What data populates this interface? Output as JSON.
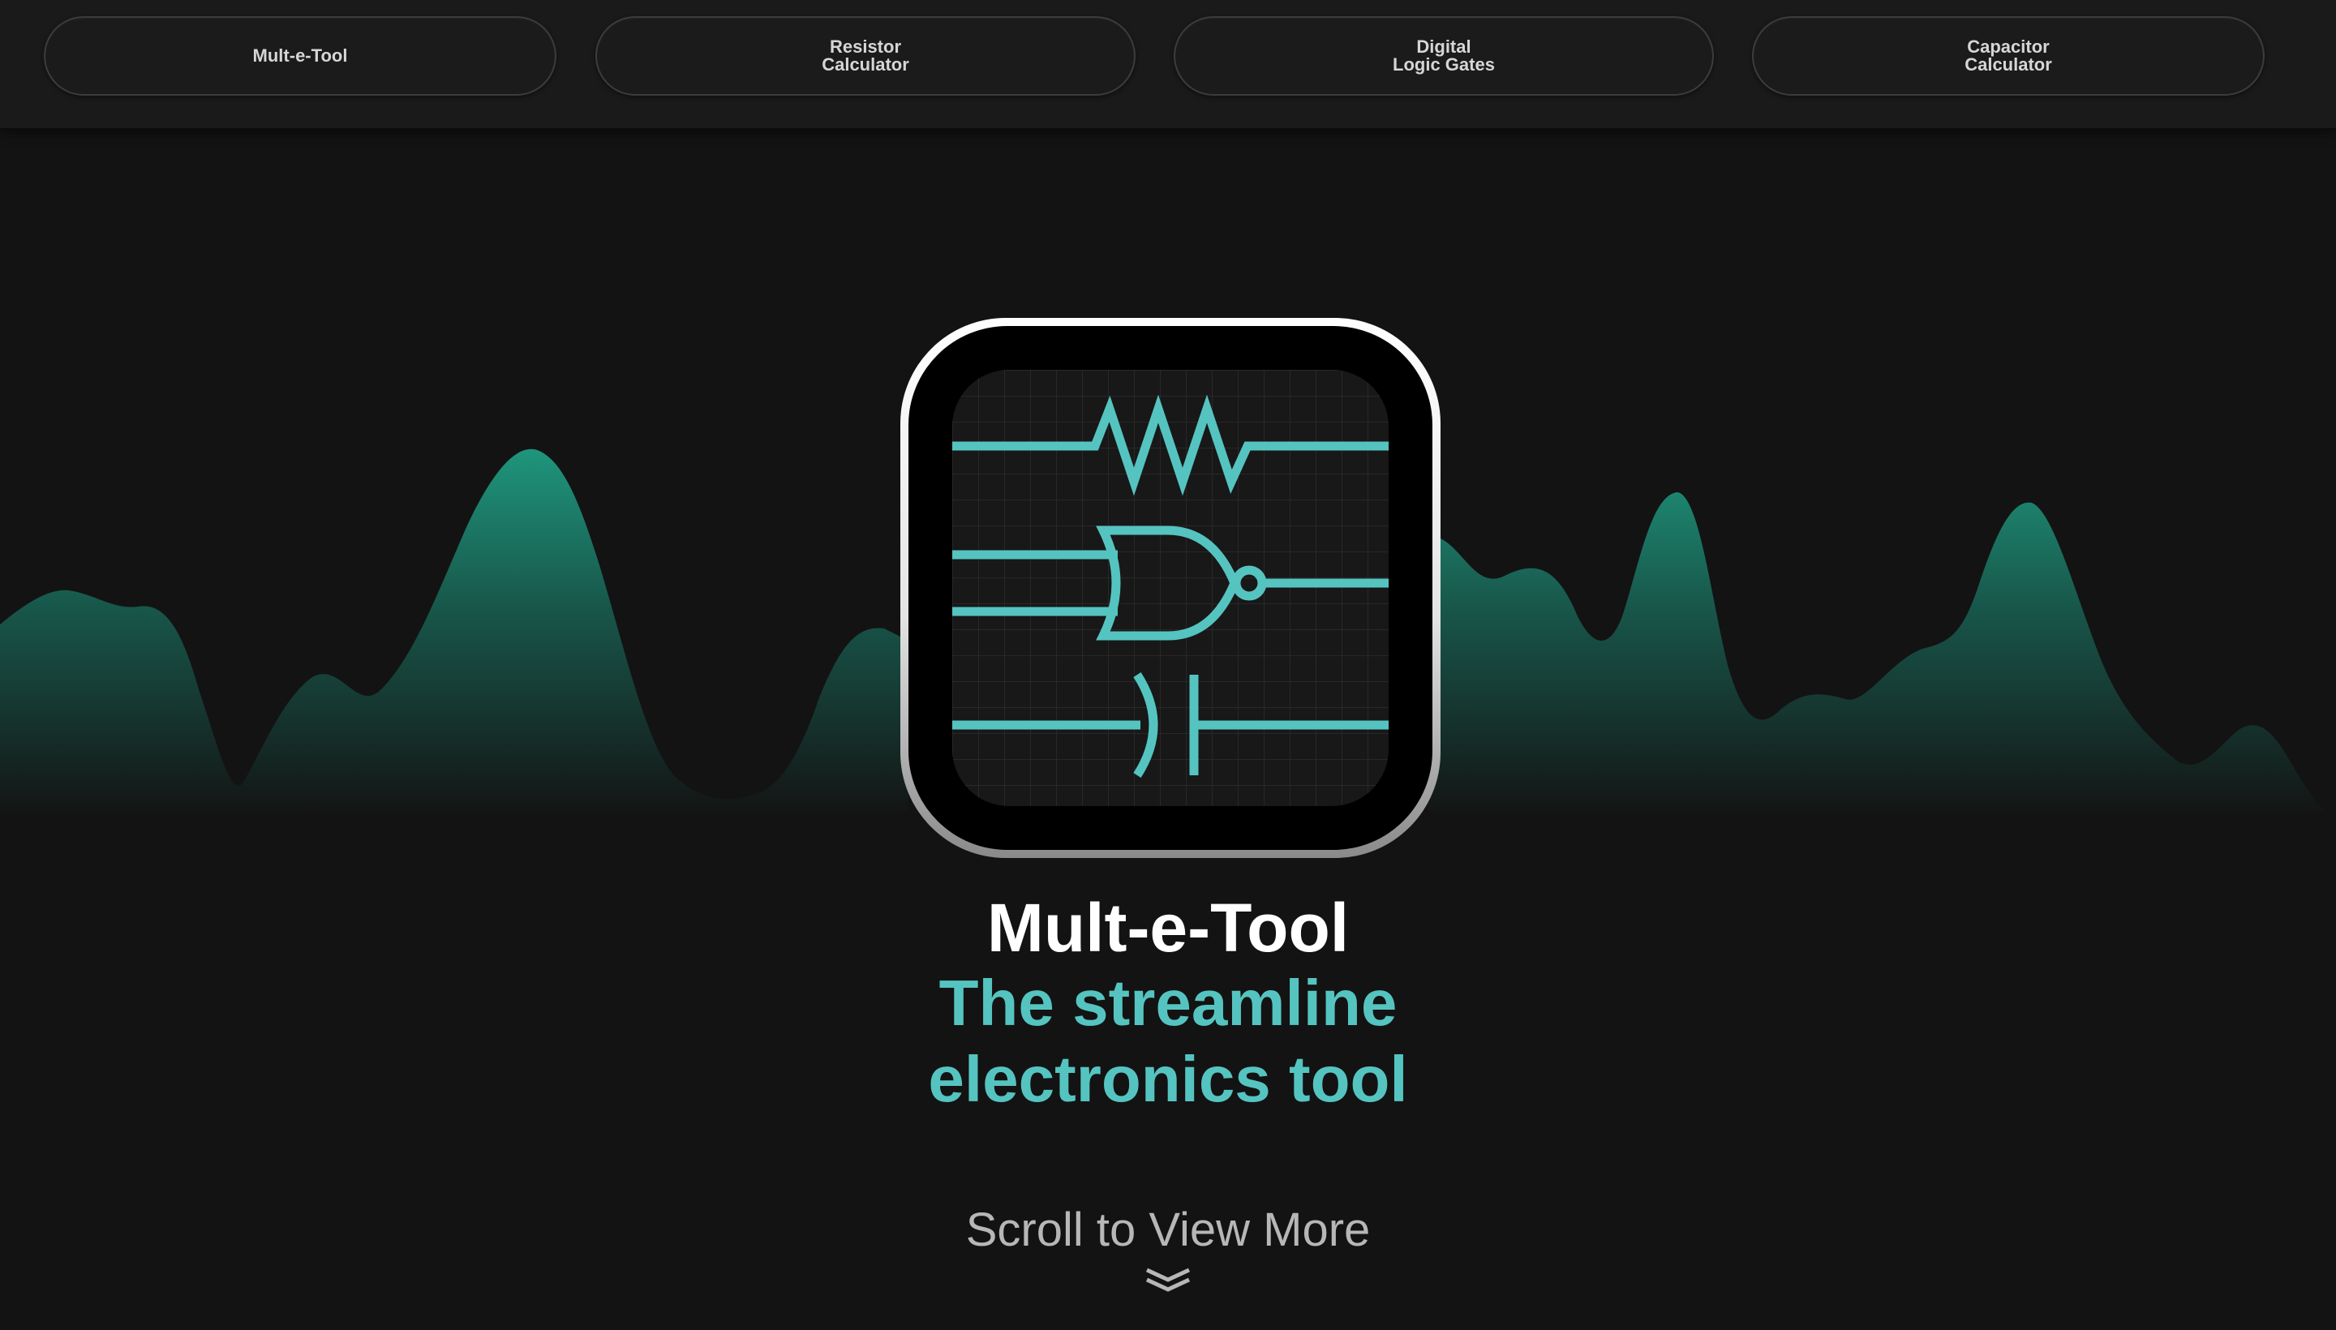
{
  "nav": {
    "items": [
      {
        "label": "Mult-e-Tool"
      },
      {
        "label": "Resistor\nCalculator"
      },
      {
        "label": "Digital\nLogic Gates"
      },
      {
        "label": "Capacitor\nCalculator"
      }
    ]
  },
  "hero": {
    "title": "Mult-e-Tool",
    "tagline_line1": "The streamline",
    "tagline_line2": "electronics tool"
  },
  "scroll": {
    "label": "Scroll to View More",
    "icon": "double-chevron-down-icon"
  },
  "app_icon": {
    "icon": "circuit-symbols-icon",
    "symbols": [
      "resistor-symbol",
      "nor-gate-symbol",
      "capacitor-symbol"
    ]
  },
  "colors": {
    "background": "#131313",
    "topbar": "#1a1a1a",
    "accent_teal": "#55c4c0",
    "wave_teal": "#1f9a80",
    "title_white": "#ffffff",
    "scroll_gray": "#b7b7b7"
  }
}
